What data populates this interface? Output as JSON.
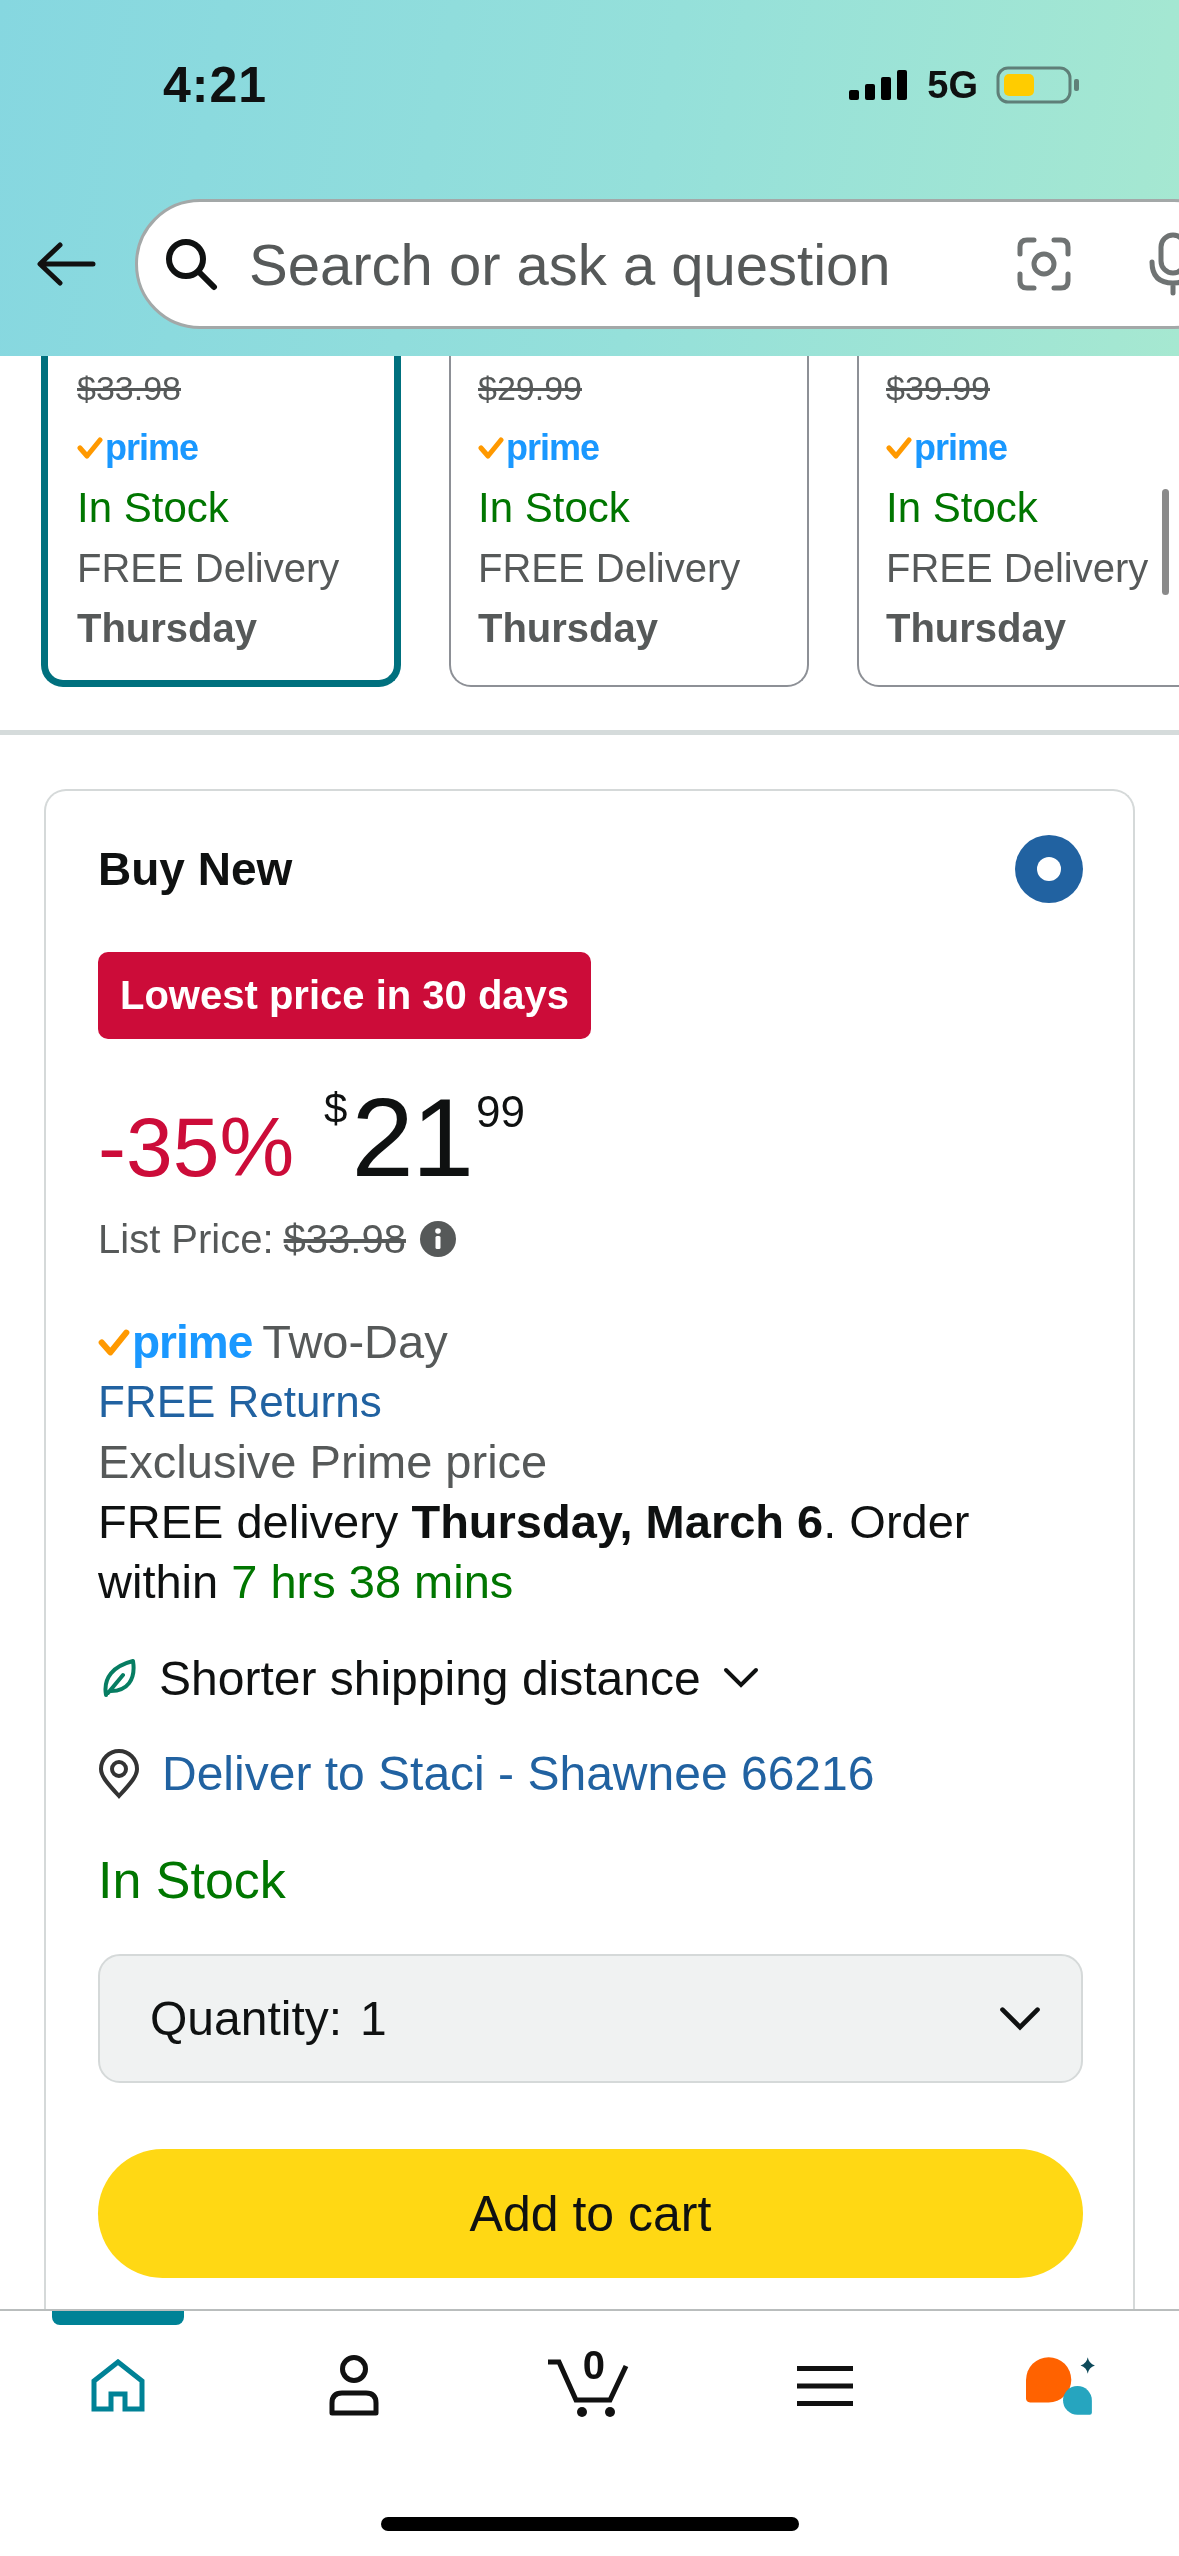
{
  "status_bar": {
    "time": "4:21",
    "network": "5G"
  },
  "search": {
    "placeholder": "Search or ask a question"
  },
  "variants": [
    {
      "list_price": "$33.98",
      "badge": "prime",
      "stock": "In Stock",
      "delivery": "FREE Delivery",
      "day": "Thursday",
      "selected": true
    },
    {
      "list_price": "$29.99",
      "badge": "prime",
      "stock": "In Stock",
      "delivery": "FREE Delivery",
      "day": "Thursday",
      "selected": false
    },
    {
      "list_price": "$39.99",
      "badge": "prime",
      "stock": "In Stock",
      "delivery": "FREE Delivery",
      "day": "Thursday",
      "selected": false
    }
  ],
  "buy_new": {
    "title": "Buy New",
    "selected": true,
    "deal_badge": "Lowest price in 30 days",
    "discount": "-35%",
    "currency": "$",
    "price_whole": "21",
    "price_fraction": "99",
    "list_price_label": "List Price:",
    "list_price": "$33.98",
    "prime_badge": "prime",
    "shipping_speed": "Two-Day",
    "returns_link": "FREE Returns",
    "prime_note": "Exclusive Prime price",
    "delivery_message": {
      "text": "FREE delivery **Thursday, March 6**. Order within",
      "countdown": "7 hrs 38 mins"
    },
    "sustainability": {
      "label": "Shorter shipping distance",
      "expanded": false
    },
    "deliver_to": "Deliver to Staci - Shawnee 66216",
    "stock": "In Stock",
    "quantity": {
      "label": "Quantity:",
      "value": "1"
    },
    "add_to_cart": "Add to cart"
  },
  "nav": [
    {
      "kind": "home",
      "selected": true
    },
    {
      "kind": "account",
      "selected": false
    },
    {
      "kind": "cart",
      "count": "0",
      "selected": false
    },
    {
      "kind": "menu",
      "selected": false
    },
    {
      "kind": "assistant",
      "selected": false
    }
  ]
}
